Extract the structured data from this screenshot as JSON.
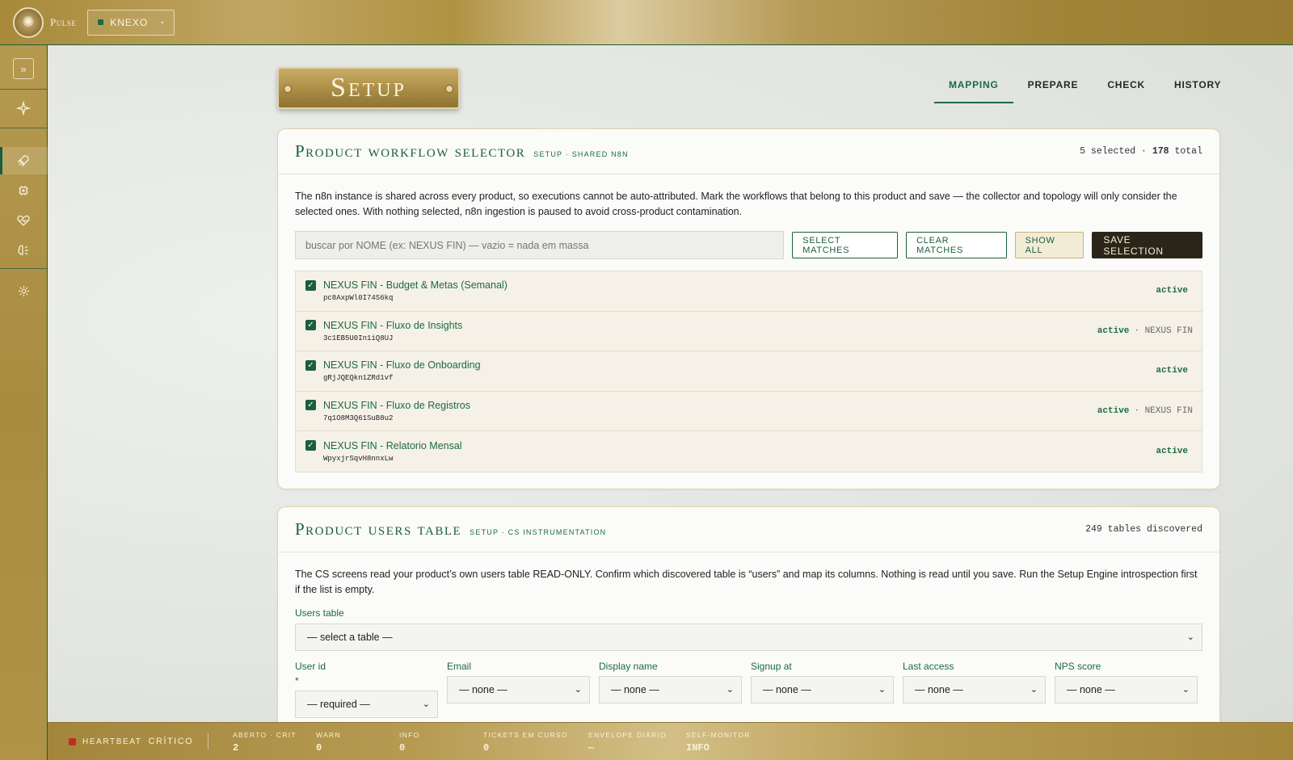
{
  "topbar": {
    "brand": "Pulse",
    "product": "KNEXO"
  },
  "page": {
    "plaque": "Setup",
    "tabs": [
      {
        "label": "MAPPING",
        "active": true
      },
      {
        "label": "PREPARE",
        "active": false
      },
      {
        "label": "CHECK",
        "active": false
      },
      {
        "label": "HISTORY",
        "active": false
      }
    ]
  },
  "workflow_card": {
    "title": "Product workflow selector",
    "subtitle": "SETUP · SHARED N8N",
    "selected": "5",
    "selected_suffix": " selected · ",
    "total": "178",
    "total_suffix": " total",
    "description": "The n8n instance is shared across every product, so executions cannot be auto-attributed. Mark the workflows that belong to this product and save — the collector and topology will only consider the selected ones. With nothing selected, n8n ingestion is paused to avoid cross-product contamination.",
    "search_placeholder": "buscar por NOME (ex: NEXUS FIN) — vazio = nada em massa",
    "buttons": {
      "select_matches": "SELECT MATCHES",
      "clear_matches": "CLEAR MATCHES",
      "show_all": "SHOW ALL",
      "save_selection": "SAVE SELECTION"
    },
    "workflows": [
      {
        "name": "NEXUS FIN - Budget & Metas (Semanal)",
        "id": "pc8AxpWl0I74S6kq",
        "status": "active",
        "tag": ""
      },
      {
        "name": "NEXUS FIN - Fluxo de Insights",
        "id": "3c1EB5U0In1iQ8UJ",
        "status": "active",
        "tag": "· NEXUS FIN"
      },
      {
        "name": "NEXUS FIN - Fluxo de Onboarding",
        "id": "gRjJQEQkn1ZRd1vf",
        "status": "active",
        "tag": ""
      },
      {
        "name": "NEXUS FIN - Fluxo de Registros",
        "id": "7q1O8M3Q61SuB8u2",
        "status": "active",
        "tag": "· NEXUS FIN"
      },
      {
        "name": "NEXUS FIN - Relatorio Mensal",
        "id": "WpyxjrSqvH8nnxLw",
        "status": "active",
        "tag": ""
      }
    ]
  },
  "users_card": {
    "title": "Product users table",
    "subtitle": "SETUP · CS INSTRUMENTATION",
    "count": "249 tables discovered",
    "description": "The CS screens read your product’s own users table READ-ONLY. Confirm which discovered table is “users” and map its columns. Nothing is read until you save. Run the Setup Engine introspection first if the list is empty.",
    "users_table_label": "Users table",
    "users_table_value": "— select a table —",
    "columns": [
      {
        "label": "User id",
        "required_mark": "*",
        "value": "— required —"
      },
      {
        "label": "Email",
        "required_mark": "",
        "value": "— none —"
      },
      {
        "label": "Display name",
        "required_mark": "",
        "value": "— none —"
      },
      {
        "label": "Signup at",
        "required_mark": "",
        "value": "— none —"
      },
      {
        "label": "Last access",
        "required_mark": "",
        "value": "— none —"
      },
      {
        "label": "NPS score",
        "required_mark": "",
        "value": "— none —"
      }
    ]
  },
  "footer": {
    "heartbeat_label": "HEARTBEAT",
    "heartbeat_state": "CRÍTICO",
    "metrics": [
      {
        "label": "ABERTO · CRIT",
        "value": "2"
      },
      {
        "label": "WARN",
        "value": "0"
      },
      {
        "label": "INFO",
        "value": "0"
      },
      {
        "label": "TICKETS EM CURSO",
        "value": "0"
      },
      {
        "label": "ENVELOPE DIÁRIO",
        "value": "—"
      },
      {
        "label": "SELF-MONITOR",
        "value": "INFO"
      }
    ]
  },
  "colors": {
    "accent_green": "#1b6b43",
    "gold": "#b09242",
    "critical_red": "#c52b21"
  }
}
